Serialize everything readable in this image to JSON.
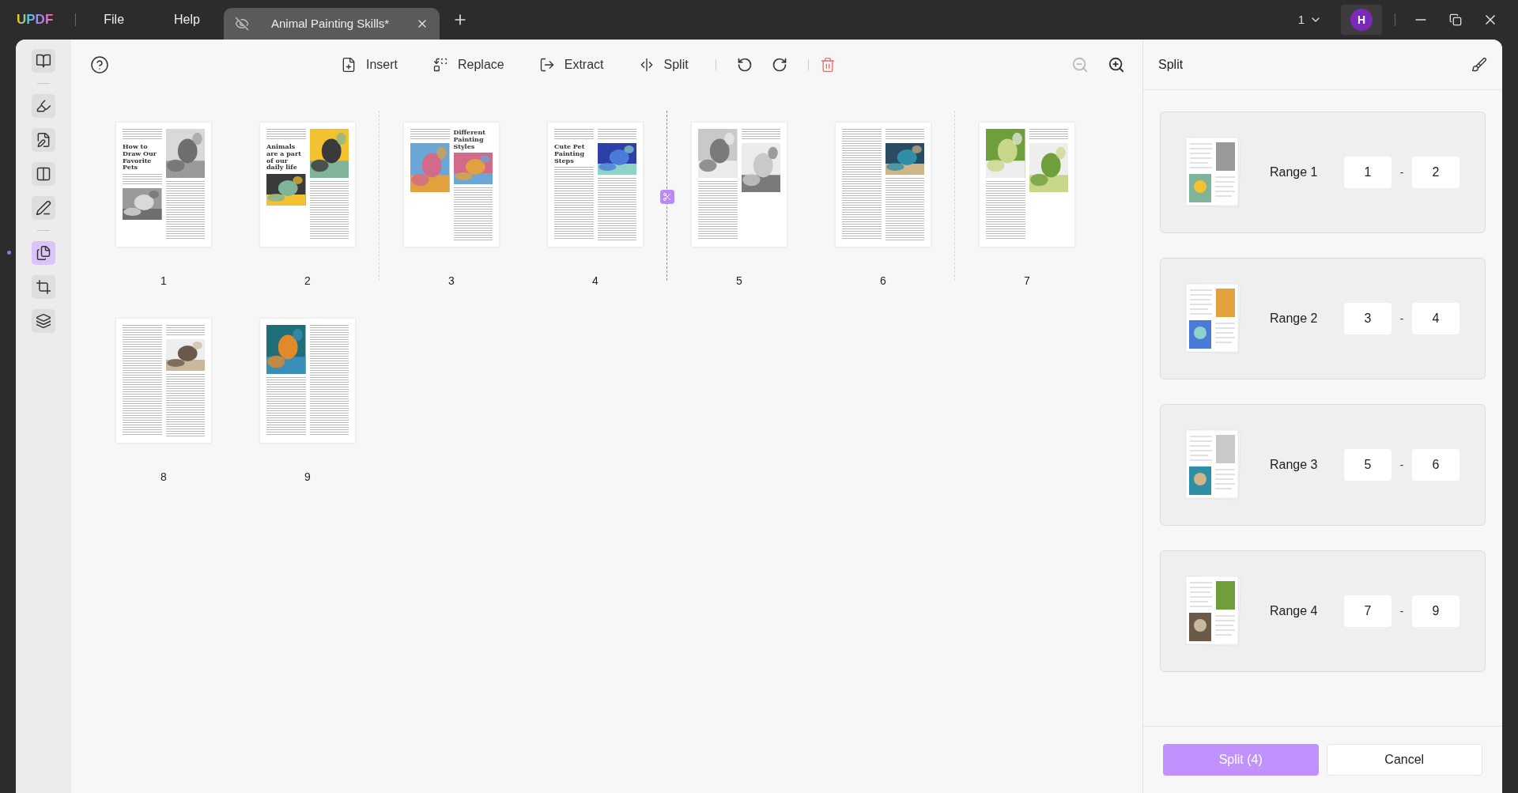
{
  "title_bar": {
    "logo": "UPDF",
    "menu": [
      "File",
      "Help"
    ],
    "tab": {
      "title": "Animal Painting Skills*"
    },
    "page_indicator": "1",
    "avatar": "H"
  },
  "sidebar": {
    "items": [
      {
        "selected": false
      },
      {
        "selected": false
      },
      {
        "selected": false
      },
      {
        "selected": false
      },
      {
        "selected": false
      },
      {
        "selected": true
      },
      {
        "selected": false
      },
      {
        "selected": false
      }
    ]
  },
  "toolbar": {
    "tools": [
      {
        "label": "Insert"
      },
      {
        "label": "Replace"
      },
      {
        "label": "Extract"
      },
      {
        "label": "Split"
      }
    ],
    "zoom_out": {
      "disabled": true
    },
    "zoom_in": {
      "disabled": false
    }
  },
  "pages": [
    {
      "number": "1",
      "headings": [
        "How to Draw Our Favorite Pets"
      ],
      "divider_after": false,
      "cut_after": false
    },
    {
      "number": "2",
      "headings": [
        "Animals are a part of our daily life"
      ],
      "divider_after": true,
      "cut_after": false
    },
    {
      "number": "3",
      "headings": [
        "Different Painting Styles"
      ],
      "divider_after": false,
      "cut_after": false
    },
    {
      "number": "4",
      "headings": [
        "Cute Pet Painting Steps"
      ],
      "divider_after": true,
      "cut_after": true
    },
    {
      "number": "5",
      "divider_after": false,
      "cut_after": false
    },
    {
      "number": "6",
      "divider_after": true,
      "cut_after": false
    },
    {
      "number": "7",
      "divider_after": false,
      "cut_after": false
    },
    {
      "number": "8",
      "divider_after": false,
      "cut_after": false
    },
    {
      "number": "9",
      "divider_after": false,
      "cut_after": false
    }
  ],
  "split_panel": {
    "title": "Split",
    "ranges": [
      {
        "label": "Range 1",
        "from": "1",
        "to": "2"
      },
      {
        "label": "Range 2",
        "from": "3",
        "to": "4"
      },
      {
        "label": "Range 3",
        "from": "5",
        "to": "6"
      },
      {
        "label": "Range 4",
        "from": "7",
        "to": "9"
      }
    ],
    "separator": "-",
    "split_button": "Split (4)",
    "cancel_button": "Cancel"
  }
}
